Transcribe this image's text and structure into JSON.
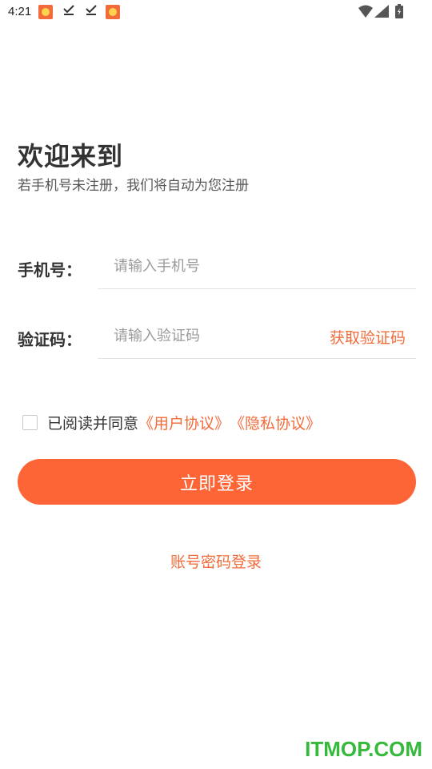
{
  "status_bar": {
    "time": "4:21"
  },
  "header": {
    "title": "欢迎来到",
    "subtitle": "若手机号未注册，我们将自动为您注册"
  },
  "form": {
    "phone_label": "手机号：",
    "phone_placeholder": "请输入手机号",
    "code_label": "验证码：",
    "code_placeholder": "请输入验证码",
    "get_code_label": "获取验证码"
  },
  "agreement": {
    "text": "已阅读并同意",
    "user_agreement": "《用户协议》",
    "privacy_agreement": "《隐私协议》"
  },
  "login_button": "立即登录",
  "alt_login": "账号密码登录",
  "watermark": "ITMOP.COM",
  "colors": {
    "accent": "#fd6436",
    "link": "#f26b3a",
    "watermark": "#35b93a"
  }
}
